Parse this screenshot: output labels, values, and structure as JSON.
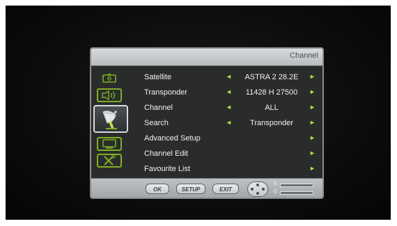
{
  "menu": {
    "title": "Channel",
    "tabs": [
      {
        "name": "picture-icon"
      },
      {
        "name": "speaker-icon"
      },
      {
        "name": "satellite-dish-icon",
        "active": true
      },
      {
        "name": "monitor-icon"
      },
      {
        "name": "tools-icon"
      }
    ],
    "rows": [
      {
        "label": "Satellite",
        "value": "ASTRA 2 28.2E",
        "left_arrow": "◄",
        "right_arrow": "►"
      },
      {
        "label": "Transponder",
        "value": "11428 H 27500",
        "left_arrow": "◄",
        "right_arrow": "►"
      },
      {
        "label": "Channel",
        "value": "ALL",
        "left_arrow": "◄",
        "right_arrow": "►"
      },
      {
        "label": "Search",
        "value": "Transponder",
        "left_arrow": "◄",
        "right_arrow": "►"
      },
      {
        "label": "Advanced Setup",
        "value": "",
        "left_arrow": "",
        "right_arrow": "►"
      },
      {
        "label": "Channel Edit",
        "value": "",
        "left_arrow": "",
        "right_arrow": "►"
      },
      {
        "label": "Favourite List",
        "value": "",
        "left_arrow": "",
        "right_arrow": "►"
      }
    ]
  },
  "bottom_bar": {
    "ok_label": "OK",
    "setup_label": "SETUP",
    "exit_label": "EXIT",
    "signal_labels": {
      "s": "S",
      "q": "Q"
    },
    "signal_strength": 0.0,
    "signal_quality": 0.0
  },
  "colors": {
    "accent_green": "#b7e04a",
    "menu_bg": "#2a2c2c",
    "title_bar": "#c9cccd"
  }
}
